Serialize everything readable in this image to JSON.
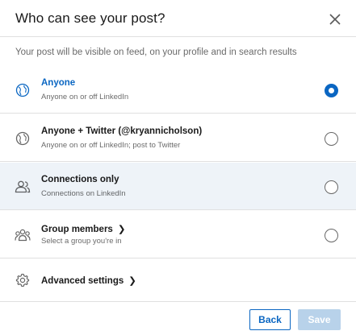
{
  "dialog": {
    "title": "Who can see your post?",
    "subtitle": "Your post will be visible on feed, on your profile and in search results"
  },
  "options": [
    {
      "label": "Anyone",
      "description": "Anyone on or off LinkedIn",
      "icon": "globe-icon",
      "selected": true
    },
    {
      "label": "Anyone + Twitter (@kryannicholson)",
      "description": "Anyone on or off LinkedIn; post to Twitter",
      "icon": "globe-icon",
      "selected": false
    },
    {
      "label": "Connections only",
      "description": "Connections on LinkedIn",
      "icon": "people-icon",
      "selected": false,
      "hovered": true
    },
    {
      "label": "Group members",
      "chevron": "❯",
      "description": "Select a group you're in",
      "icon": "group-icon",
      "selected": false
    }
  ],
  "advanced": {
    "label": "Advanced settings",
    "chevron": "❯",
    "icon": "gear-icon"
  },
  "footer": {
    "back_label": "Back",
    "save_label": "Save"
  },
  "colors": {
    "accent": "#0a66c2",
    "hover_row": "#eef3f8",
    "disabled_button": "#b8d2ea"
  }
}
